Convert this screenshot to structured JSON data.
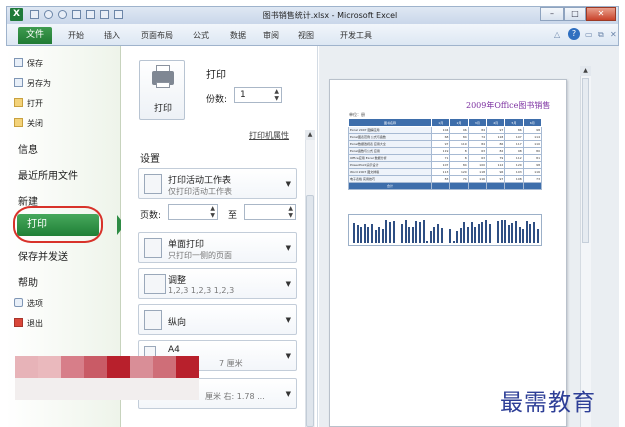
{
  "window": {
    "title": "图书销售统计.xlsx - Microsoft Excel",
    "app_icon_label": "X",
    "buttons": [
      "minimize",
      "maximize",
      "close"
    ]
  },
  "ribbon": {
    "file_tab": "文件",
    "tabs": [
      "开始",
      "插入",
      "页面布局",
      "公式",
      "数据",
      "审阅",
      "视图",
      "开发工具"
    ],
    "right_icons": [
      "minimize-ribbon-icon",
      "help-icon",
      "restore-window-icon",
      "close-workbook-icon"
    ]
  },
  "backstage": {
    "quick_items": [
      {
        "label": "保存",
        "icon": "save-icon"
      },
      {
        "label": "另存为",
        "icon": "save-as-icon"
      },
      {
        "label": "打开",
        "icon": "open-folder-icon"
      },
      {
        "label": "关闭",
        "icon": "close-file-icon"
      }
    ],
    "info": "信息",
    "recent": "最近所用文件",
    "new": "新建",
    "print": "打印",
    "save_send": "保存并发送",
    "help": "帮助",
    "options": "选项",
    "exit": "退出"
  },
  "print_panel": {
    "heading": "打印",
    "big_button": "打印",
    "copies_label": "份数:",
    "copies_value": "1",
    "printer_properties_link": "打印机属性",
    "settings_heading": "设置",
    "active_sheets_title": "打印活动工作表",
    "active_sheets_desc": "仅打印活动工作表",
    "pages_label": "页数:",
    "to_label": "至",
    "one_sided_title": "单面打印",
    "one_sided_desc": "只打印一侧的页面",
    "collate_title": "调整",
    "collate_desc": "1,2,3    1,2,3    1,2,3",
    "orientation_title": "纵向",
    "paper_title": "A4",
    "paper_desc": "7 厘米",
    "margins_desc": "厘米   右: 1.78 ..."
  },
  "preview": {
    "sheet_title": "2009年Office图书销售",
    "sheet_subtitle": "单位：册",
    "table_header": [
      "图书名称",
      "1月",
      "2月",
      "3月",
      "4月",
      "5月",
      "6月"
    ],
    "table_rows": [
      [
        "Excel 2007 图解应用",
        "104",
        "96",
        "84",
        "97",
        "86",
        "98"
      ],
      [
        "Excel图表范例 公式与函数",
        "68",
        "84",
        "74",
        "118",
        "107",
        "114"
      ],
      [
        "Excel数据透视表 应用大全",
        "97",
        "119",
        "84",
        "86",
        "117",
        "110"
      ],
      [
        "Excel函数与公式 应用",
        "119",
        "8",
        "63",
        "82",
        "98",
        "80"
      ],
      [
        "Office应用 Excel 数据分析",
        "71",
        "8",
        "63",
        "79",
        "112",
        "81"
      ],
      [
        "PowerPoint演示设计",
        "107",
        "84",
        "100",
        "112",
        "120",
        "98"
      ],
      [
        "Word 2007 图文排版",
        "113",
        "120",
        "118",
        "96",
        "103",
        "116"
      ],
      [
        "电子表格 实用技巧",
        "83",
        "74",
        "116",
        "97",
        "108",
        "73"
      ]
    ],
    "table_total_label": "合计"
  },
  "watermark": "最需教育",
  "colors": {
    "file_tab": "#1f7a33",
    "print_selected": "#2e8b44",
    "highlight_ring": "#d8322a",
    "table_header": "#3e6eab",
    "sheet_title": "#7b2fa0",
    "watermark": "#2e3f97"
  }
}
